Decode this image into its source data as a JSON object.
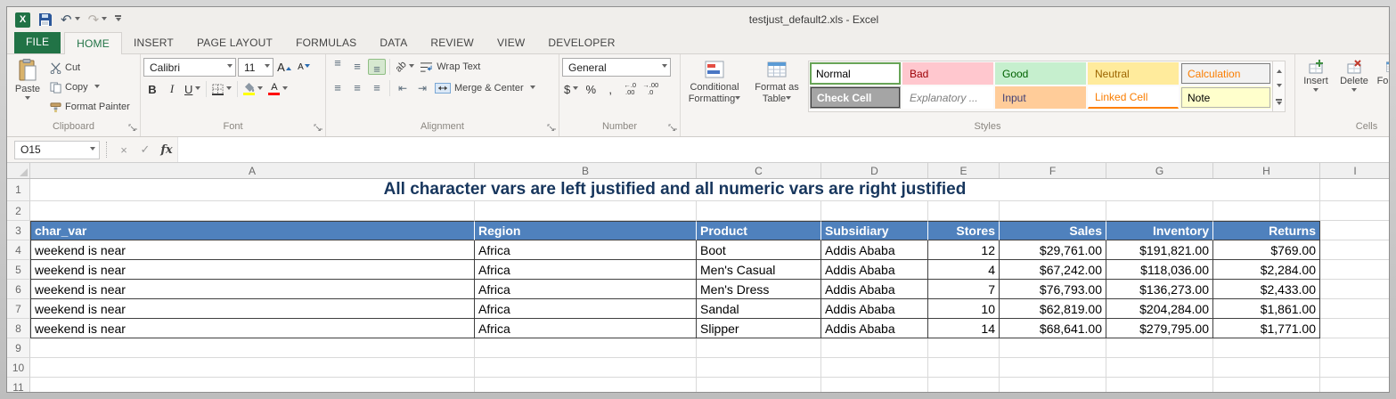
{
  "window": {
    "title": "testjust_default2.xls - Excel"
  },
  "colors": {
    "excel_green": "#217346",
    "fill_color_bar": "#FFFF00",
    "font_color_bar": "#FF0000",
    "table_header_bg": "#4F81BD",
    "sheet_title_text": "#17365D"
  },
  "icon_glyphs": {
    "undo": "↶",
    "redo": "↷",
    "cancel": "×",
    "enter": "✓",
    "align": "≡",
    "orientation": "ab",
    "outdent": "⇤",
    "indent": "⇥",
    "grow_font": "A",
    "shrink_font": "A",
    "font_color": "A",
    "inc_dec_top": "←.0",
    "inc_dec_bot": ".00",
    "dec_dec_top": "→.00",
    "dec_dec_bot": ".0"
  },
  "ribbon_tabs": [
    {
      "label": "FILE",
      "file": true
    },
    {
      "label": "HOME",
      "active": true
    },
    {
      "label": "INSERT"
    },
    {
      "label": "PAGE LAYOUT"
    },
    {
      "label": "FORMULAS"
    },
    {
      "label": "DATA"
    },
    {
      "label": "REVIEW"
    },
    {
      "label": "VIEW"
    },
    {
      "label": "DEVELOPER"
    }
  ],
  "ribbon": {
    "clipboard": {
      "label": "Clipboard",
      "paste": "Paste",
      "cut": "Cut",
      "copy": "Copy",
      "format_painter": "Format Painter"
    },
    "font": {
      "label": "Font",
      "family": "Calibri",
      "size": "11",
      "bold": "B",
      "italic": "I",
      "underline": "U"
    },
    "alignment": {
      "label": "Alignment",
      "wrap_text": "Wrap Text",
      "merge_center": "Merge & Center"
    },
    "number": {
      "label": "Number",
      "format": "General",
      "currency": "$",
      "percent": "%",
      "comma": ","
    },
    "styles": {
      "label": "Styles",
      "conditional_formatting": "Conditional Formatting",
      "format_as_table": "Format as Table",
      "gallery": [
        {
          "label": "Normal",
          "bg": "#FFFFFF",
          "color": "#000000",
          "selected": true
        },
        {
          "label": "Bad",
          "bg": "#FFC7CE",
          "color": "#9C0006"
        },
        {
          "label": "Good",
          "bg": "#C6EFCE",
          "color": "#006100"
        },
        {
          "label": "Neutral",
          "bg": "#FFEB9C",
          "color": "#9C6500"
        },
        {
          "label": "Calculation",
          "bg": "#F2F2F2",
          "color": "#FA7D00",
          "border": "#7F7F7F"
        },
        {
          "label": "Check Cell",
          "bg": "#A5A5A5",
          "color": "#FFFFFF",
          "border": "#3F3F3F",
          "bold": true
        },
        {
          "label": "Explanatory ...",
          "bg": "#FFFFFF",
          "color": "#7F7F7F",
          "italic": true
        },
        {
          "label": "Input",
          "bg": "#FFCC99",
          "color": "#3F3F76"
        },
        {
          "label": "Linked Cell",
          "bg": "#FFFFFF",
          "color": "#FA7D00",
          "underline": "#FF8001"
        },
        {
          "label": "Note",
          "bg": "#FFFFCC",
          "color": "#000000",
          "border": "#B2B2B2"
        }
      ]
    },
    "cells": {
      "label": "Cells",
      "insert": "Insert",
      "delete": "Delete",
      "format": "Format"
    }
  },
  "formula_bar": {
    "name_box": "O15",
    "fx_label": "fx",
    "value": ""
  },
  "sheet": {
    "col_headers": [
      "A",
      "B",
      "C",
      "D",
      "E",
      "F",
      "G",
      "H",
      "I"
    ],
    "row_headers": [
      "1",
      "2",
      "3",
      "4",
      "5",
      "6",
      "7",
      "8",
      "9",
      "10",
      "11"
    ],
    "title": {
      "row": 1,
      "text": "All character vars are left justified and all numeric vars are right justified",
      "color": "#17365D"
    },
    "table": {
      "header_row": 3,
      "data_start_row": 4,
      "header_bg": "#4F81BD",
      "header_color": "#FFFFFF",
      "columns": [
        {
          "header": "char_var",
          "align": "left"
        },
        {
          "header": "Region",
          "align": "left"
        },
        {
          "header": "Product",
          "align": "left"
        },
        {
          "header": "Subsidiary",
          "align": "left"
        },
        {
          "header": "Stores",
          "align": "right"
        },
        {
          "header": "Sales",
          "align": "right"
        },
        {
          "header": "Inventory",
          "align": "right"
        },
        {
          "header": "Returns",
          "align": "right"
        }
      ],
      "rows": [
        [
          "weekend is near",
          "Africa",
          "Boot",
          "Addis Ababa",
          "12",
          "$29,761.00",
          "$191,821.00",
          "$769.00"
        ],
        [
          "weekend is near",
          "Africa",
          "Men's Casual",
          "Addis Ababa",
          "4",
          "$67,242.00",
          "$118,036.00",
          "$2,284.00"
        ],
        [
          "weekend is near",
          "Africa",
          "Men's Dress",
          "Addis Ababa",
          "7",
          "$76,793.00",
          "$136,273.00",
          "$2,433.00"
        ],
        [
          "weekend is near",
          "Africa",
          "Sandal",
          "Addis Ababa",
          "10",
          "$62,819.00",
          "$204,284.00",
          "$1,861.00"
        ],
        [
          "weekend is near",
          "Africa",
          "Slipper",
          "Addis Ababa",
          "14",
          "$68,641.00",
          "$279,795.00",
          "$1,771.00"
        ]
      ]
    }
  }
}
